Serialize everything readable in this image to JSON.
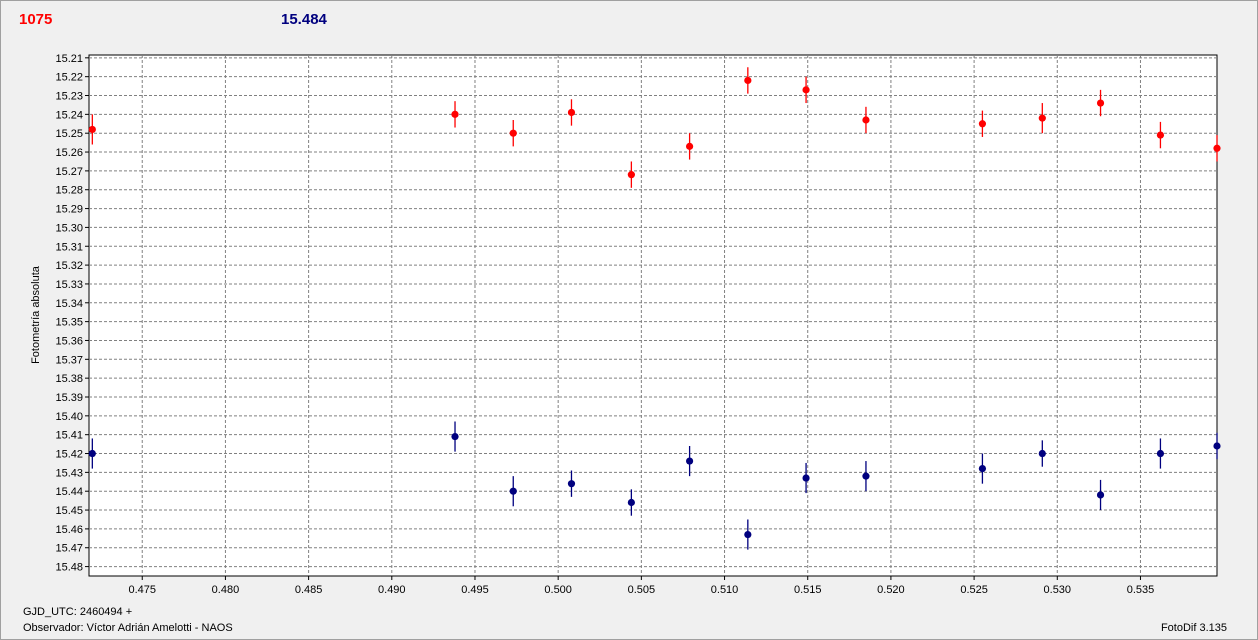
{
  "header": {
    "left_value": "1075",
    "right_value": "15.484"
  },
  "footer": {
    "gjd": "GJD_UTC: 2460494 +",
    "observer": "Observador: Víctor Adrián Amelotti - NAOS",
    "software": "FotoDif 3.135"
  },
  "colors": {
    "series_1": "#ff0000",
    "series_2": "#00007f"
  },
  "chart_data": {
    "type": "scatter",
    "ylabel": "Fotometría absoluta",
    "xlabel": "",
    "xlim": [
      0.4718,
      0.5396
    ],
    "ylim": [
      15.2085,
      15.485
    ],
    "y_inverted": true,
    "grid": true,
    "x_ticks": [
      "0.475",
      "0.480",
      "0.485",
      "0.490",
      "0.495",
      "0.500",
      "0.505",
      "0.510",
      "0.515",
      "0.520",
      "0.525",
      "0.530",
      "0.535"
    ],
    "y_ticks": [
      "15.21",
      "15.22",
      "15.23",
      "15.24",
      "15.25",
      "15.26",
      "15.27",
      "15.28",
      "15.29",
      "15.30",
      "15.31",
      "15.32",
      "15.33",
      "15.34",
      "15.35",
      "15.36",
      "15.37",
      "15.38",
      "15.39",
      "15.40",
      "15.41",
      "15.42",
      "15.43",
      "15.44",
      "15.45",
      "15.46",
      "15.47",
      "15.48"
    ],
    "series": [
      {
        "color": "#ff0000",
        "x": [
          0.472,
          0.4938,
          0.4973,
          0.5008,
          0.5044,
          0.5079,
          0.5114,
          0.5149,
          0.5185,
          0.5255,
          0.5291,
          0.5326,
          0.5362,
          0.5396
        ],
        "y": [
          15.248,
          15.24,
          15.25,
          15.239,
          15.272,
          15.257,
          15.222,
          15.227,
          15.243,
          15.245,
          15.242,
          15.234,
          15.251,
          15.258
        ],
        "err": [
          0.008,
          0.007,
          0.007,
          0.007,
          0.007,
          0.007,
          0.007,
          0.007,
          0.007,
          0.007,
          0.008,
          0.007,
          0.007,
          0.007
        ]
      },
      {
        "color": "#00007f",
        "x": [
          0.472,
          0.4938,
          0.4973,
          0.5008,
          0.5044,
          0.5079,
          0.5114,
          0.5149,
          0.5185,
          0.5255,
          0.5291,
          0.5326,
          0.5362,
          0.5396
        ],
        "y": [
          15.42,
          15.411,
          15.44,
          15.436,
          15.446,
          15.424,
          15.463,
          15.433,
          15.432,
          15.428,
          15.42,
          15.442,
          15.42,
          15.416
        ],
        "err": [
          0.008,
          0.008,
          0.008,
          0.007,
          0.007,
          0.008,
          0.008,
          0.008,
          0.008,
          0.008,
          0.007,
          0.008,
          0.008,
          0.007
        ]
      }
    ]
  }
}
